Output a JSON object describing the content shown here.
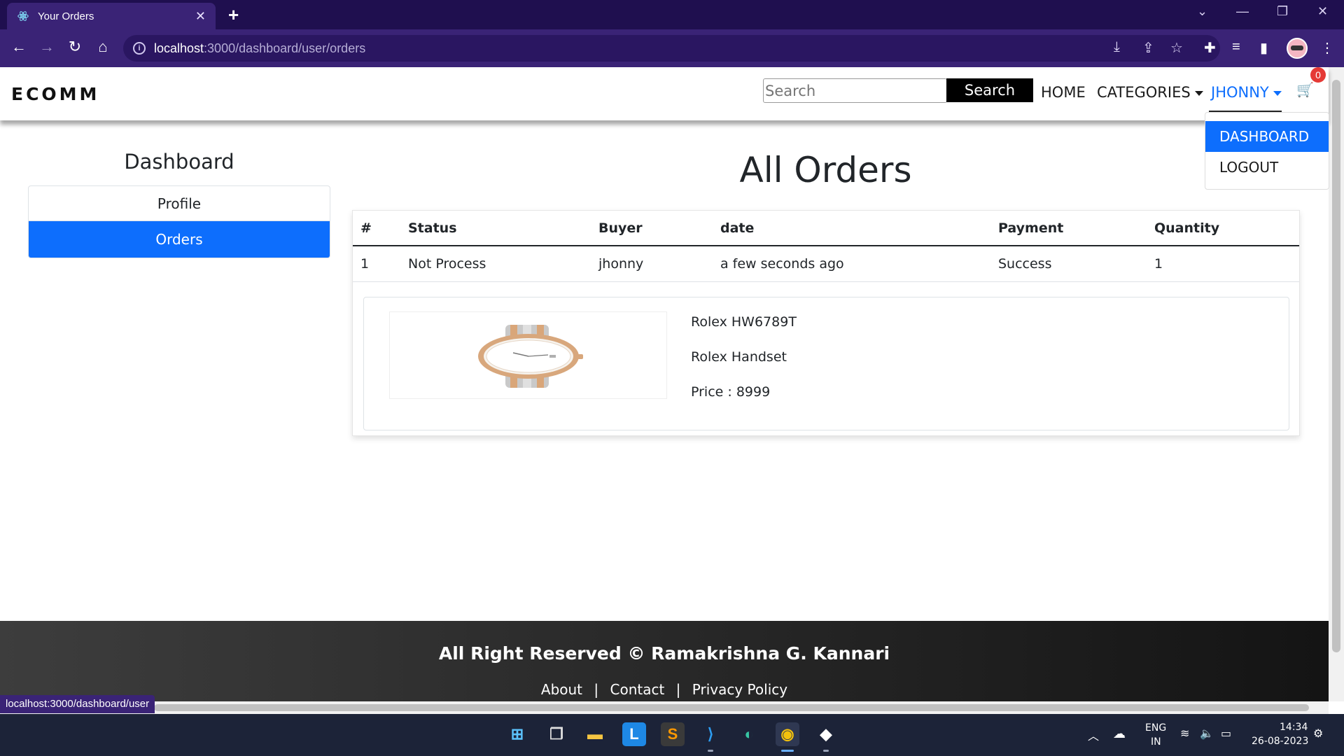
{
  "browser": {
    "tab_title": "Your Orders",
    "tab_close": "✕",
    "new_tab": "+",
    "url_host": "localhost",
    "url_path": ":3000/dashboard/user/orders",
    "status_url": "localhost:3000/dashboard/user"
  },
  "navbar": {
    "brand": "ECOMM",
    "search_placeholder": "Search",
    "search_button": "Search",
    "home": "HOME",
    "categories": "CATEGORIES",
    "user": "JHONNY",
    "cart_count": "0"
  },
  "user_menu": {
    "items": [
      {
        "label": "DASHBOARD",
        "active": true
      },
      {
        "label": "LOGOUT",
        "active": false
      }
    ]
  },
  "sidebar": {
    "title": "Dashboard",
    "items": [
      {
        "label": "Profile",
        "active": false
      },
      {
        "label": "Orders",
        "active": true
      }
    ]
  },
  "main": {
    "title": "All Orders",
    "table": {
      "headers": [
        "#",
        "Status",
        "Buyer",
        "date",
        "Payment",
        "Quantity"
      ],
      "rows": [
        [
          "1",
          "Not Process",
          "jhonny",
          "a few seconds ago",
          "Success",
          "1"
        ]
      ]
    },
    "product": {
      "name": "Rolex HW6789T",
      "description": "Rolex Handset",
      "price": "Price : 8999"
    }
  },
  "footer": {
    "copyright": "All Right Reserved © Ramakrishna G. Kannari",
    "links": [
      "About",
      "Contact",
      "Privacy Policy"
    ],
    "separator": "|"
  },
  "taskbar": {
    "lang_line1": "ENG",
    "lang_line2": "IN",
    "time": "14:34",
    "date": "26-08-2023"
  },
  "colors": {
    "accent": "#0d6efd",
    "browser_frame": "#1f0f4f",
    "browser_toolbar": "#3a2376",
    "badge": "#e53935"
  }
}
